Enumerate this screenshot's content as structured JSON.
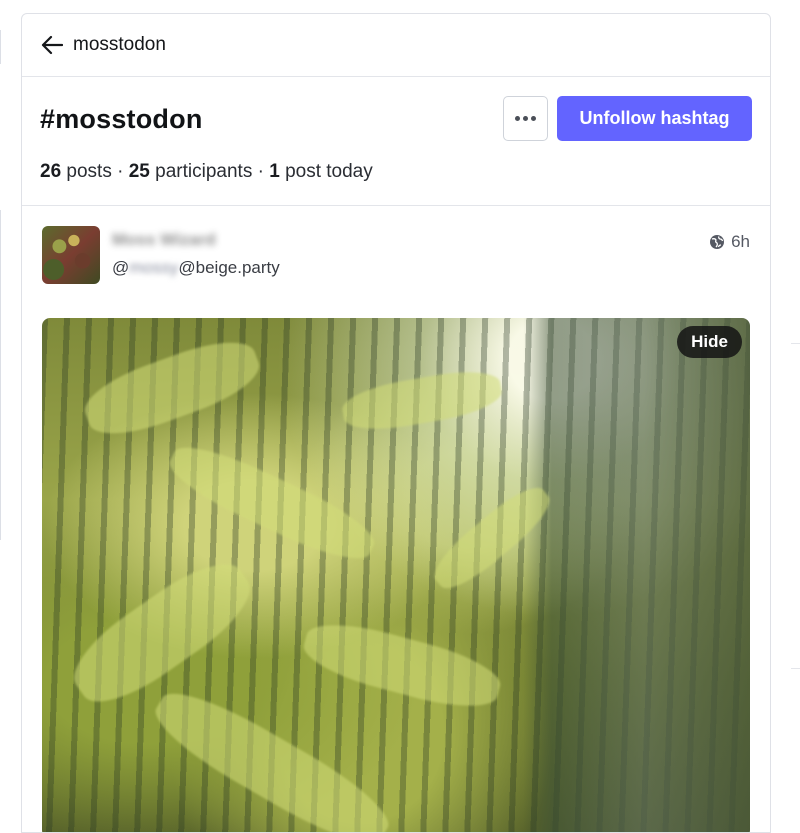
{
  "topbar": {
    "back_label": "mosstodon"
  },
  "hashtag": {
    "title": "#mosstodon",
    "more_label": "•••",
    "unfollow_label": "Unfollow hashtag",
    "stats": {
      "posts_count": "26",
      "posts_label": "posts",
      "separator": "·",
      "participants_count": "25",
      "participants_label": "participants",
      "today_count": "1",
      "today_label": "post today"
    }
  },
  "post": {
    "display_name": "Moss Wizard",
    "handle_prefix": "@",
    "handle_user": "mossy",
    "handle_domain": "@beige.party",
    "visibility_icon": "globe-icon",
    "timestamp": "6h",
    "media": {
      "hide_label": "Hide"
    }
  },
  "colors": {
    "accent": "#6364ff",
    "border": "#dfe1e7",
    "text": "#1f2328"
  }
}
